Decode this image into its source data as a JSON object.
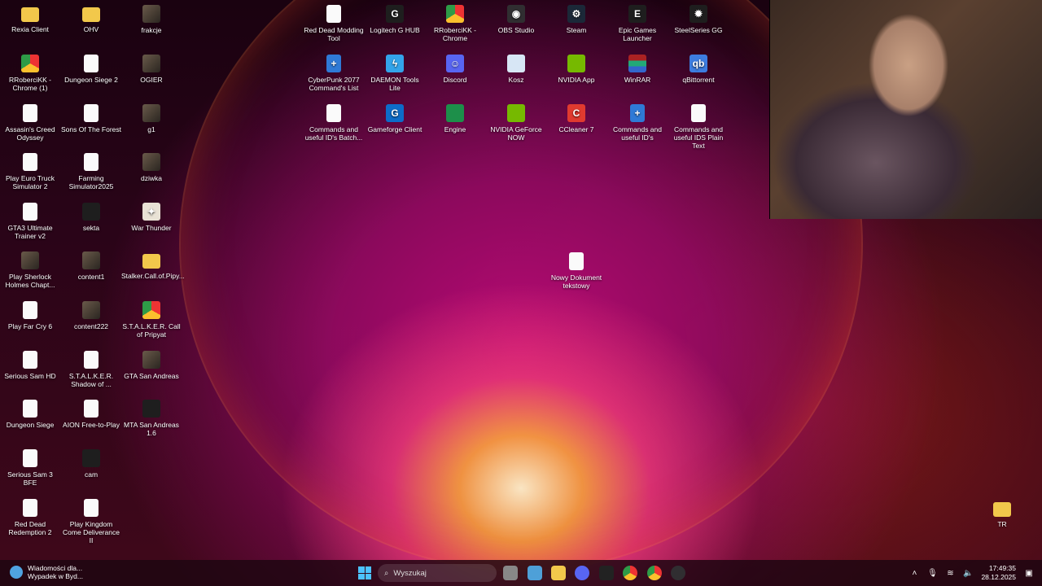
{
  "desktop": {
    "icons": [
      {
        "label": "Rexia Client",
        "type": "folder"
      },
      {
        "label": "OHV",
        "type": "folder"
      },
      {
        "label": "frakcje",
        "type": "image"
      },
      {
        "label": "RRoberciKK - Chrome (1)",
        "type": "chrome"
      },
      {
        "label": "Dungeon Siege 2",
        "type": "document"
      },
      {
        "label": "OGIER",
        "type": "image"
      },
      {
        "label": "Assasin's Creed Odyssey",
        "type": "document"
      },
      {
        "label": "Sons Of The Forest",
        "type": "document"
      },
      {
        "label": "g1",
        "type": "image"
      },
      {
        "label": "Play Euro Truck Simulator 2",
        "type": "document"
      },
      {
        "label": "Farming Simulator2025",
        "type": "document"
      },
      {
        "label": "dziwka",
        "type": "image"
      },
      {
        "label": "GTA3 Ultimate Trainer v2",
        "type": "app"
      },
      {
        "label": "sekta",
        "type": "image"
      },
      {
        "label": "War Thunder",
        "type": "war"
      },
      {
        "label": "Play Sherlock Holmes Chapt...",
        "type": "image"
      },
      {
        "label": "content1",
        "type": "image"
      },
      {
        "label": "Stalker.Call.of.Pipy...",
        "type": "folder"
      },
      {
        "label": "Play Far Cry 6",
        "type": "document"
      },
      {
        "label": "content222",
        "type": "image"
      },
      {
        "label": "S.T.A.L.K.E.R. Call of Pripyat",
        "type": "chrome"
      },
      {
        "label": "Serious Sam HD",
        "type": "document"
      },
      {
        "label": "S.T.A.L.K.E.R. Shadow of ...",
        "type": "document"
      },
      {
        "label": "GTA San Andreas",
        "type": "image"
      },
      {
        "label": "Dungeon Siege",
        "type": "document"
      },
      {
        "label": "AION Free-to-Play",
        "type": "document"
      },
      {
        "label": "MTA San Andreas 1.6",
        "type": "image"
      },
      {
        "label": "Serious Sam 3 BFE",
        "type": "document"
      },
      {
        "label": "cam",
        "type": "image"
      },
      {
        "label": "Red Dead Redemption 2",
        "type": "app"
      },
      {
        "label": "Play Kingdom Come Deliverance II",
        "type": "document"
      },
      {
        "label": "Red Dead Modding Tool",
        "type": "document"
      },
      {
        "label": "Logitech G HUB",
        "type": "dark"
      },
      {
        "label": "RRoberciKK - Chrome",
        "type": "chrome"
      },
      {
        "label": "OBS Studio",
        "type": "obs"
      },
      {
        "label": "Steam",
        "type": "steam"
      },
      {
        "label": "Epic Games Launcher",
        "type": "dark"
      },
      {
        "label": "SteelSeries GG",
        "type": "dark"
      },
      {
        "label": "CyberPunk 2077 Command's List",
        "type": "document-blue"
      },
      {
        "label": "DAEMON Tools Lite",
        "type": "daemon"
      },
      {
        "label": "Discord",
        "type": "discord"
      },
      {
        "label": "Kosz",
        "type": "bin"
      },
      {
        "label": "NVIDIA App",
        "type": "green"
      },
      {
        "label": "WinRAR",
        "type": "winrar"
      },
      {
        "label": "qBittorrent",
        "type": "qb"
      },
      {
        "label": "Commands and useful ID's Batch...",
        "type": "document"
      },
      {
        "label": "Gameforge Client",
        "type": "gf"
      },
      {
        "label": "Engine",
        "type": "engine"
      },
      {
        "label": "NVIDIA GeForce NOW",
        "type": "green"
      },
      {
        "label": "CCleaner 7",
        "type": "cc"
      },
      {
        "label": "Commands and useful ID's",
        "type": "document-blue"
      },
      {
        "label": "Commands and useful IDS Plain Text",
        "type": "document"
      },
      {
        "label": "Nowy Dokument tekstowy",
        "type": "document"
      },
      {
        "label": "TR",
        "type": "folder"
      }
    ]
  },
  "taskbar": {
    "news_title": "Wiadomości dla...",
    "news_subtitle": "Wypadek w Byd...",
    "search_placeholder": "Wyszukaj",
    "time": "17:49:35",
    "date": "28.12.2025"
  },
  "colors": {
    "accent": "#4cc2ff"
  }
}
